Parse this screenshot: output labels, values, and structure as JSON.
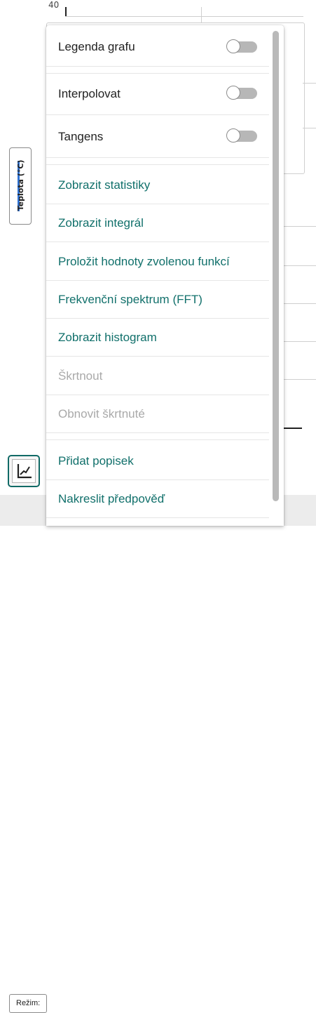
{
  "graph": {
    "y_tick_top": "40",
    "axis_label": "Teplota (°C)",
    "axis_color": "#2f73d4",
    "tool_button_icon": "line-graph-icon"
  },
  "bottom_bar": {
    "mode_label": "Režim:"
  },
  "menu": {
    "toggles": [
      {
        "label": "Legenda grafu",
        "on": false
      },
      {
        "label": "Interpolovat",
        "on": false
      },
      {
        "label": "Tangens",
        "on": false
      }
    ],
    "actions": [
      {
        "label": "Zobrazit statistiky",
        "enabled": true
      },
      {
        "label": "Zobrazit integrál",
        "enabled": true
      },
      {
        "label": "Proložit hodnoty zvolenou funkcí",
        "enabled": true
      },
      {
        "label": "Frekvenční spektrum (FFT)",
        "enabled": true
      },
      {
        "label": "Zobrazit histogram",
        "enabled": true
      },
      {
        "label": "Škrtnout",
        "enabled": false
      },
      {
        "label": "Obnovit škrtnuté",
        "enabled": false
      }
    ],
    "extra": [
      {
        "label": "Přidat popisek",
        "enabled": true
      },
      {
        "label": "Nakreslit předpověď",
        "enabled": true
      }
    ],
    "accent_color": "#11706b",
    "disabled_color": "#a9a9a9"
  }
}
